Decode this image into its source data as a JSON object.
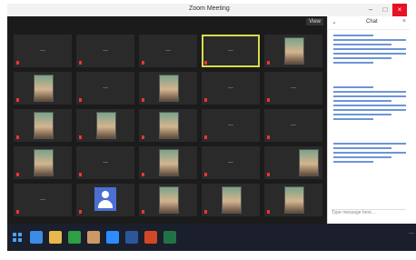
{
  "window": {
    "title": "Zoom Meeting",
    "controls": [
      "–",
      "□",
      "×"
    ]
  },
  "gallery": {
    "view_label": "View",
    "tiles": [
      {
        "label": "…",
        "photo": ""
      },
      {
        "label": "…",
        "photo": ""
      },
      {
        "label": "…",
        "photo": ""
      },
      {
        "label": "…",
        "photo": "",
        "active": true
      },
      {
        "label": "",
        "photo": "c"
      },
      {
        "label": "",
        "photo": "c"
      },
      {
        "label": "…",
        "photo": ""
      },
      {
        "label": "",
        "photo": "c"
      },
      {
        "label": "…",
        "photo": ""
      },
      {
        "label": "…",
        "photo": ""
      },
      {
        "label": "",
        "photo": "c"
      },
      {
        "label": "",
        "photo": "c"
      },
      {
        "label": "",
        "photo": "c"
      },
      {
        "label": "…",
        "photo": ""
      },
      {
        "label": "…",
        "photo": ""
      },
      {
        "label": "",
        "photo": "c"
      },
      {
        "label": "…",
        "photo": ""
      },
      {
        "label": "",
        "photo": "c"
      },
      {
        "label": "…",
        "photo": ""
      },
      {
        "label": "",
        "photo": "r"
      },
      {
        "label": "…",
        "photo": ""
      },
      {
        "label": "",
        "avatar": true
      },
      {
        "label": "",
        "photo": "c"
      },
      {
        "label": "",
        "photo": "c"
      },
      {
        "label": "",
        "photo": "c"
      }
    ]
  },
  "chat": {
    "title": "Chat",
    "close": "×",
    "messages": [
      {
        "lines": [
          "s",
          "l",
          "m",
          "l",
          "l",
          "m",
          "s"
        ]
      },
      {
        "lines": [
          "s",
          "l",
          "l",
          "m",
          "l",
          "l",
          "m",
          "s"
        ]
      },
      {
        "lines": [
          "l",
          "m",
          "l",
          "m",
          "s"
        ]
      }
    ],
    "input_placeholder": "Type message here..."
  },
  "taskbar": {
    "apps": [
      "start",
      "ie",
      "file-explorer",
      "chrome",
      "photos",
      "zoom",
      "word",
      "powerpoint",
      "excel"
    ],
    "tray_text": "…"
  }
}
